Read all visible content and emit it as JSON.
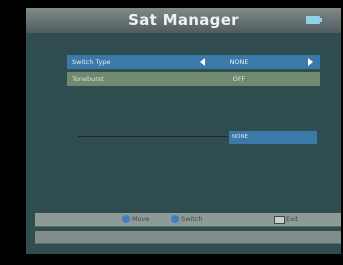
{
  "title": "Sat Manager",
  "rows": [
    {
      "label": "Switch Type",
      "value": "NONE"
    },
    {
      "label": "Toneburst",
      "value": "OFF"
    }
  ],
  "status": "NONE",
  "help": {
    "move": "Move",
    "switch": "Switch",
    "exit": "Exit"
  }
}
